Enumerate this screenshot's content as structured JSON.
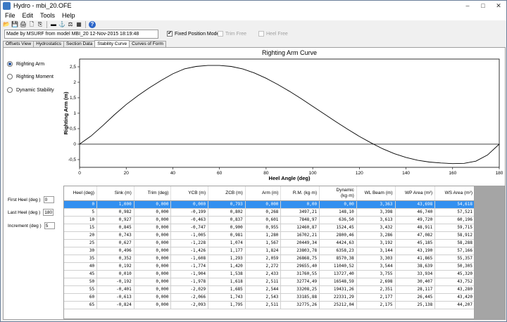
{
  "window": {
    "title": "Hydro - mbi_20.OFE",
    "min": "–",
    "max": "□",
    "close": "✕"
  },
  "menu": [
    "File",
    "Edit",
    "Tools",
    "Help"
  ],
  "toolbar": {
    "icons": [
      "folder-open-icon",
      "save-icon",
      "print-icon",
      "print-preview-icon",
      "copy-icon",
      "table-icon",
      "ship-icon",
      "balance-icon",
      "chart-icon",
      "help-icon"
    ],
    "glyphs": [
      "📂",
      "💾",
      "🖨",
      "🗋",
      "⎘",
      "▬",
      "⚓",
      "⚖",
      "▦",
      "?"
    ]
  },
  "options": {
    "info": "Made by MSURF from model MBI_20  12-Nov-2015  18:19:48",
    "fixed_position": {
      "label": "Fixed Position Mode",
      "checked": true
    },
    "trim_free": {
      "label": "Trim Free",
      "checked": false
    },
    "heel_free": {
      "label": "Heel Free",
      "checked": false
    }
  },
  "tabs": [
    "Offsets View",
    "Hydrostatics",
    "Section Data",
    "Stability Curve",
    "Curves of Form"
  ],
  "active_tab": 3,
  "radios": [
    {
      "label": "Righting Arm",
      "checked": true
    },
    {
      "label": "Righting Moment",
      "checked": false
    },
    {
      "label": "Dynamic Stability",
      "checked": false
    }
  ],
  "inputs": {
    "first_heel": {
      "label": "First Heel (deg )",
      "value": "0"
    },
    "last_heel": {
      "label": "Last Heel (deg )",
      "value": "180"
    },
    "increment": {
      "label": "Increment (deg )",
      "value": "5"
    }
  },
  "chart_data": {
    "type": "line",
    "title": "Righting Arm Curve",
    "xlabel": "Heel Angle (deg)",
    "ylabel": "Righting Arm (m)",
    "xlim": [
      0,
      180
    ],
    "ylim": [
      -0.75,
      2.75
    ],
    "xticks": [
      0,
      20,
      40,
      60,
      80,
      100,
      120,
      140,
      160,
      180
    ],
    "yticks": [
      -0.5,
      0,
      0.5,
      1,
      1.5,
      2,
      2.5
    ],
    "ytick_labels": [
      "-0,5",
      "0",
      "0,5",
      "1",
      "1,5",
      "2",
      "2,5"
    ],
    "grid": false,
    "series": [
      {
        "x": [
          0,
          5,
          10,
          15,
          20,
          25,
          30,
          35,
          40,
          45,
          50,
          55,
          60,
          65,
          70,
          75,
          80,
          85,
          90,
          95,
          100,
          105,
          110,
          115,
          120,
          125,
          130,
          135,
          140,
          145,
          150,
          155,
          160,
          165,
          170,
          175,
          180
        ],
        "y": [
          0,
          0.268,
          0.601,
          0.955,
          1.28,
          1.567,
          1.824,
          2.059,
          2.272,
          2.433,
          2.511,
          2.544,
          2.543,
          2.511,
          2.43,
          2.3,
          2.13,
          1.93,
          1.71,
          1.47,
          1.22,
          0.97,
          0.72,
          0.48,
          0.25,
          0.04,
          -0.15,
          -0.31,
          -0.43,
          -0.52,
          -0.58,
          -0.61,
          -0.63,
          -0.62,
          -0.55,
          -0.35,
          0
        ]
      }
    ]
  },
  "table": {
    "columns": [
      "Heel (deg)",
      "Sink (m)",
      "Trim (deg)",
      "YCB (m)",
      "ZCB (m)",
      "Arm (m)",
      "R.M. (kg·m)",
      "Dynamic (kg·m)",
      "WL Beam (m)",
      "WP Area (m²)",
      "WS Area (m²)"
    ],
    "rows": [
      [
        "0",
        "1,000",
        "0,000",
        "0,000",
        "0,793",
        "0,000",
        "0,00",
        "0,00",
        "3,363",
        "43,698",
        "54,618"
      ],
      [
        "5",
        "0,982",
        "0,000",
        "-0,199",
        "0,802",
        "0,268",
        "3497,21",
        "148,10",
        "3,398",
        "46,740",
        "57,521"
      ],
      [
        "10",
        "0,927",
        "0,000",
        "-0,463",
        "0,837",
        "0,601",
        "7848,97",
        "636,50",
        "3,613",
        "49,720",
        "60,196"
      ],
      [
        "15",
        "0,845",
        "0,000",
        "-0,747",
        "0,900",
        "0,955",
        "12460,87",
        "1524,45",
        "3,432",
        "48,911",
        "59,715"
      ],
      [
        "20",
        "0,743",
        "0,000",
        "-1,005",
        "0,981",
        "1,280",
        "16702,21",
        "2800,46",
        "3,286",
        "47,082",
        "58,912"
      ],
      [
        "25",
        "0,627",
        "0,000",
        "-1,228",
        "1,074",
        "1,567",
        "20449,34",
        "4424,63",
        "3,192",
        "45,185",
        "58,288"
      ],
      [
        "30",
        "0,496",
        "0,000",
        "-1,426",
        "1,177",
        "1,824",
        "23803,78",
        "6358,23",
        "3,144",
        "43,190",
        "57,166"
      ],
      [
        "35",
        "0,352",
        "0,000",
        "-1,608",
        "1,293",
        "2,059",
        "26868,75",
        "8570,38",
        "3,303",
        "41,865",
        "55,357"
      ],
      [
        "40",
        "0,192",
        "0,000",
        "-1,774",
        "1,420",
        "2,272",
        "29655,40",
        "11040,52",
        "3,544",
        "38,639",
        "50,305"
      ],
      [
        "45",
        "0,010",
        "0,000",
        "-1,904",
        "1,538",
        "2,433",
        "31760,55",
        "13727,40",
        "3,755",
        "33,934",
        "45,320"
      ],
      [
        "50",
        "-0,192",
        "0,000",
        "-1,978",
        "1,618",
        "2,511",
        "32774,49",
        "16548,59",
        "2,698",
        "30,407",
        "43,752"
      ],
      [
        "55",
        "-0,401",
        "0,000",
        "-2,029",
        "1,685",
        "2,544",
        "33208,25",
        "19431,26",
        "2,351",
        "28,117",
        "43,280"
      ],
      [
        "60",
        "-0,613",
        "0,000",
        "-2,066",
        "1,743",
        "2,543",
        "33185,88",
        "22331,29",
        "2,177",
        "26,445",
        "43,420"
      ],
      [
        "65",
        "-0,824",
        "0,000",
        "-2,093",
        "1,795",
        "2,511",
        "32775,26",
        "25212,04",
        "2,175",
        "25,138",
        "44,207"
      ]
    ],
    "selected_row": 0
  }
}
